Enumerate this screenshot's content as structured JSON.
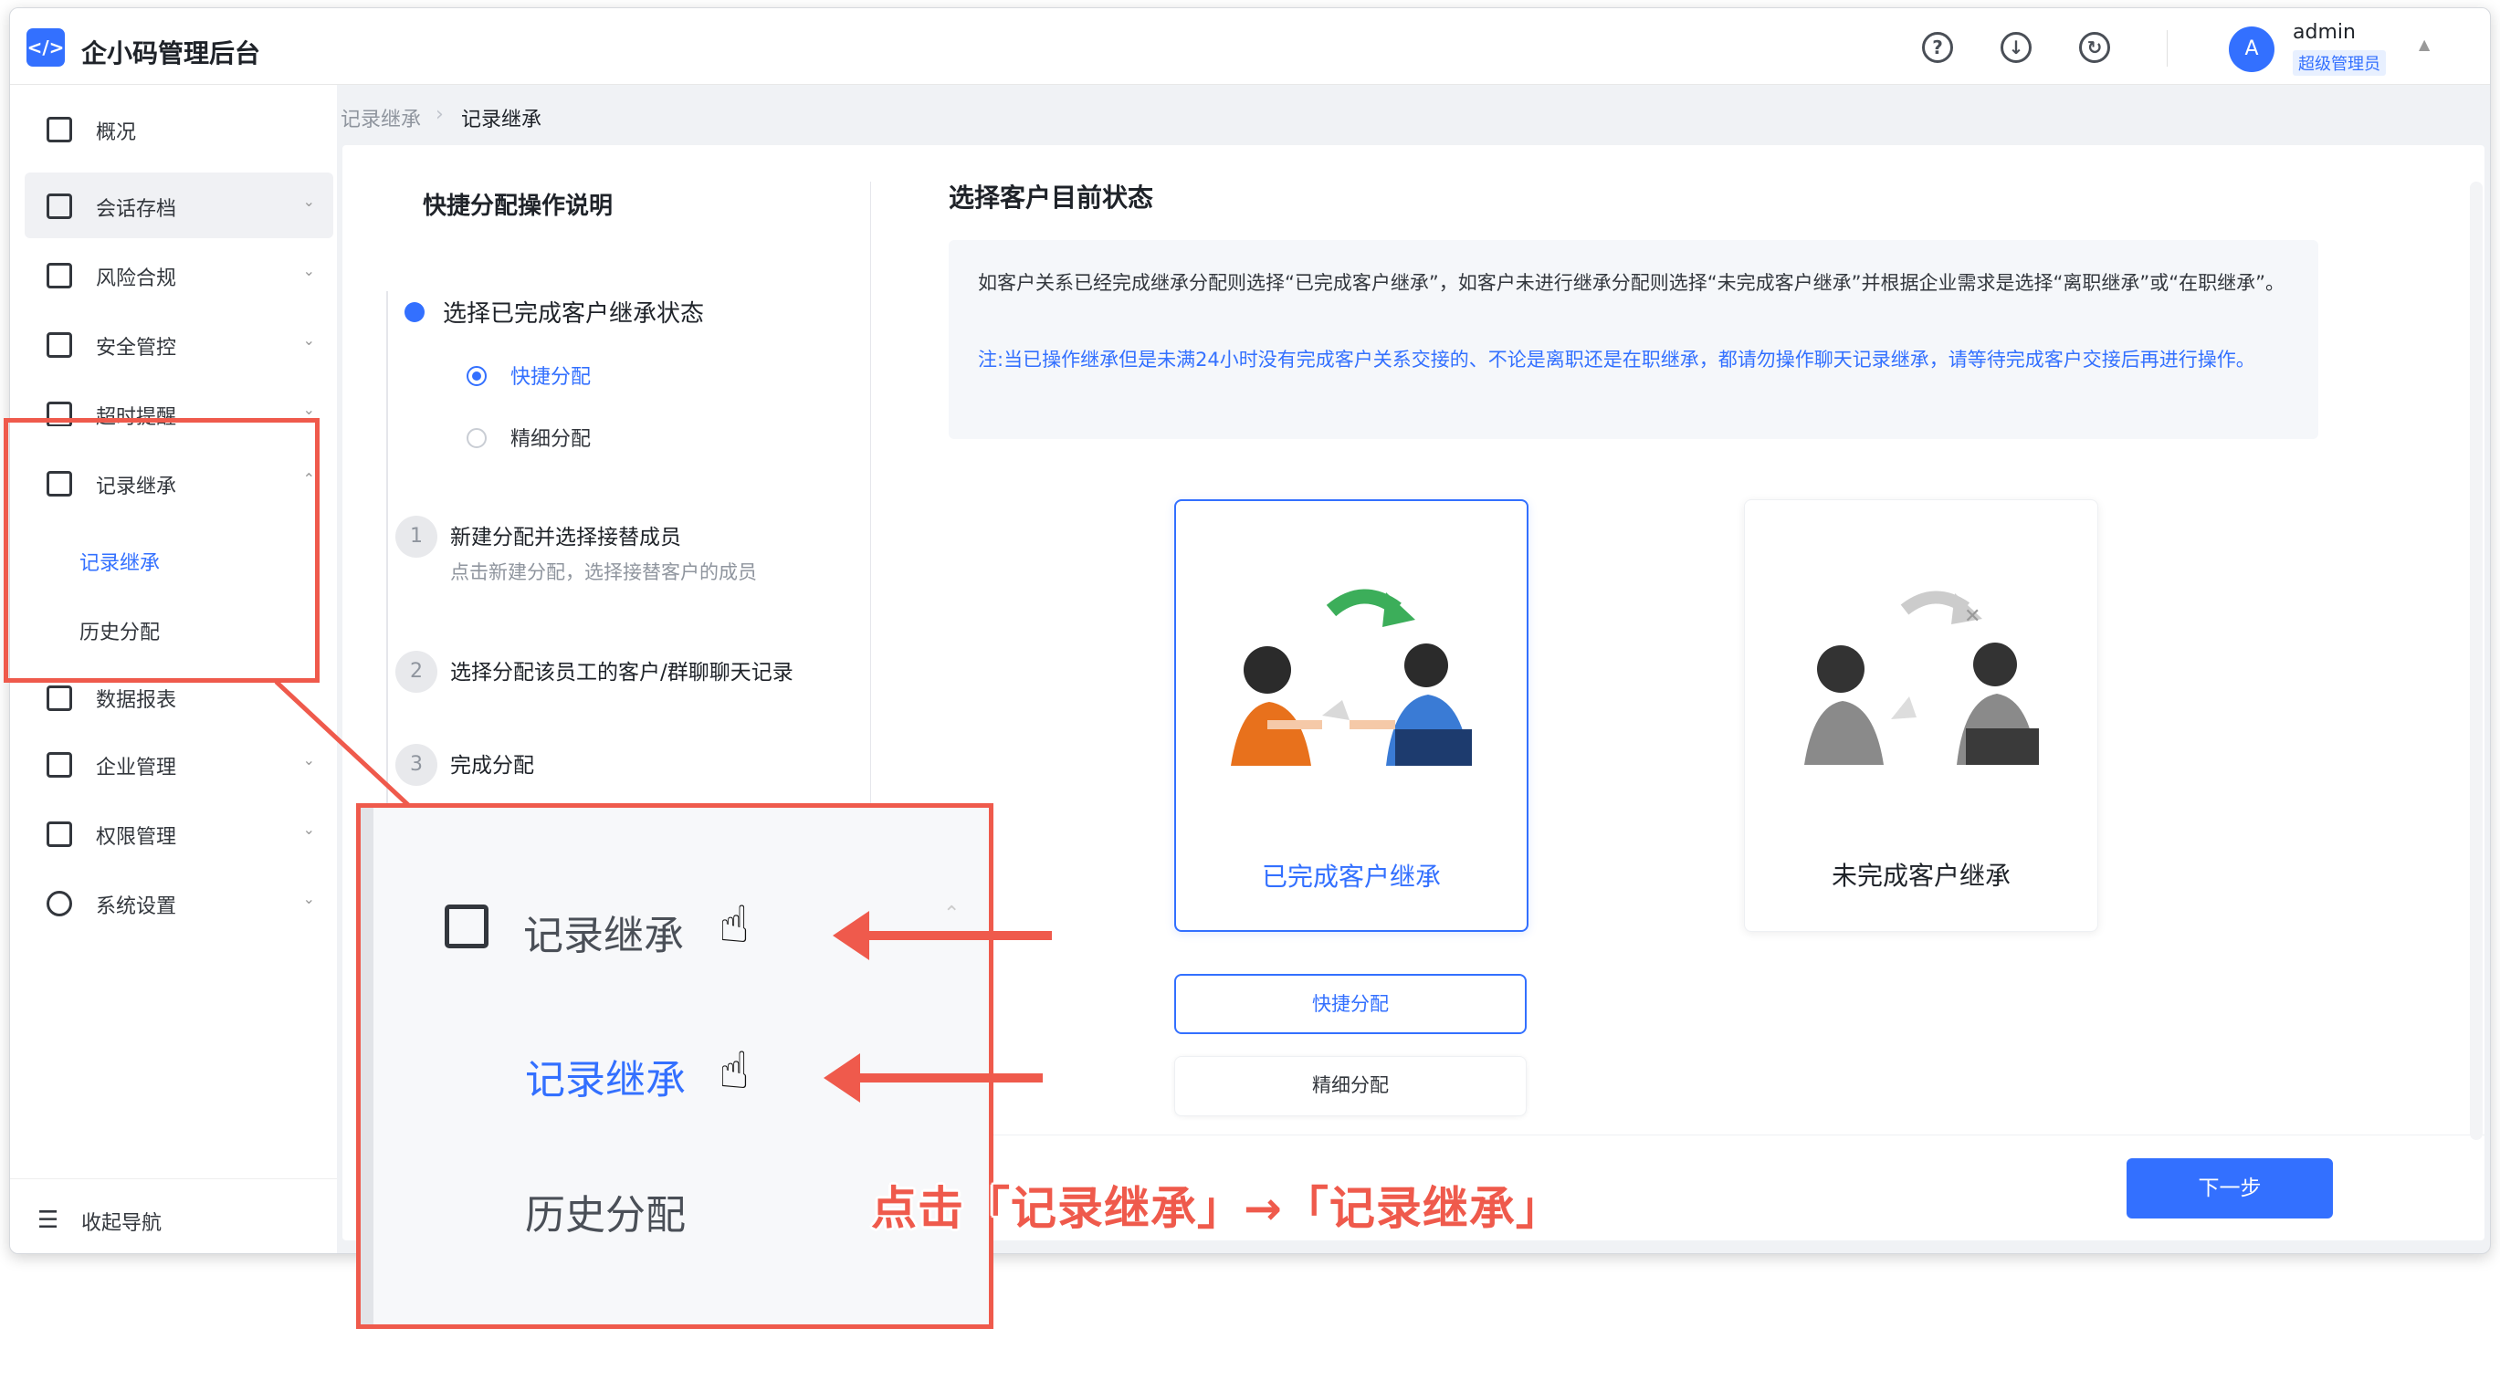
{
  "app": {
    "title": "企小码管理后台",
    "logo_glyph": "</>"
  },
  "header": {
    "icons": [
      "help-icon",
      "cloud-download-icon",
      "refresh-icon"
    ],
    "user": {
      "avatar": "A",
      "name": "admin",
      "role": "超级管理员"
    }
  },
  "sidebar": {
    "items": [
      {
        "label": "概况",
        "icon": "building-icon"
      },
      {
        "label": "会话存档",
        "icon": "folder-icon"
      },
      {
        "label": "风险合规",
        "icon": "alert-doc-icon"
      },
      {
        "label": "安全管控",
        "icon": "shield-check-icon"
      },
      {
        "label": "超时提醒",
        "icon": "clock-bell-icon"
      },
      {
        "label": "记录继承",
        "icon": "record-inherit-icon"
      },
      {
        "label": "数据报表",
        "icon": "chart-icon"
      },
      {
        "label": "企业管理",
        "icon": "org-icon"
      },
      {
        "label": "权限管理",
        "icon": "permission-icon"
      },
      {
        "label": "系统设置",
        "icon": "settings-icon"
      }
    ],
    "sub_items": [
      "记录继承",
      "历史分配"
    ],
    "collapse_label": "收起导航"
  },
  "breadcrumb": [
    "记录继承",
    "记录继承"
  ],
  "steps": {
    "title": "快捷分配操作说明",
    "main_step": "选择已完成客户继承状态",
    "radio_options": [
      "快捷分配",
      "精细分配"
    ],
    "numbered": [
      {
        "num": "1",
        "label": "新建分配并选择接替成员",
        "desc": "点击新建分配，选择接替客户的成员"
      },
      {
        "num": "2",
        "label": "选择分配该员工的客户/群聊聊天记录",
        "desc": ""
      },
      {
        "num": "3",
        "label": "完成分配",
        "desc": ""
      }
    ]
  },
  "selection": {
    "title": "选择客户目前状态",
    "notice": "如客户关系已经完成继承分配则选择“已完成客户继承”，如客户未进行继承分配则选择“未完成客户继承”并根据企业需求是选择“离职继承”或“在职继承”。",
    "warning": "注:当已操作继承但是未满24小时没有完成客户关系交接的、不论是离职还是在职继承，都请勿操作聊天记录继承，请等待完成客户交接后再进行操作。",
    "options": [
      {
        "label": "已完成客户继承",
        "selected": true
      },
      {
        "label": "未完成客户继承",
        "selected": false
      }
    ],
    "buttons": {
      "quick": "快捷分配",
      "fine": "精细分配"
    }
  },
  "footer": {
    "next": "下一步"
  },
  "annotation": {
    "zoom_items": [
      "记录继承",
      "记录继承",
      "历史分配"
    ],
    "callout": "点击「记录继承」→「记录继承」",
    "color": "#ef5a4c"
  },
  "colors": {
    "primary": "#3370ff",
    "highlight": "#ef5a4c"
  }
}
